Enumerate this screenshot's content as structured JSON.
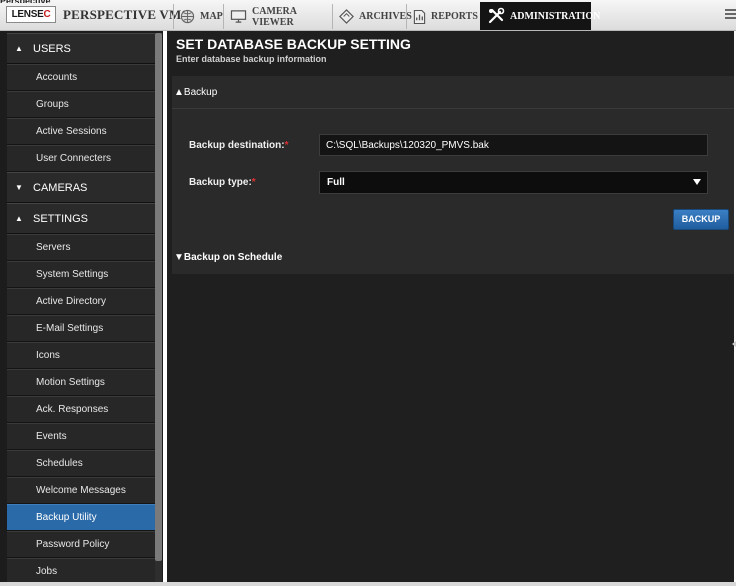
{
  "header": {
    "window_title": "Perspective",
    "logo_text": "LENSEC",
    "app_name": "PERSPECTIVE VMS",
    "tabs": [
      {
        "label": "MAP",
        "icon": "globe-icon"
      },
      {
        "label": "CAMERA VIEWER",
        "icon": "monitor-icon"
      },
      {
        "label": "ARCHIVES",
        "icon": "diamond-icon"
      },
      {
        "label": "REPORTS",
        "icon": "report-icon"
      },
      {
        "label": "ADMINISTRATION",
        "icon": "tools-icon",
        "active": true
      }
    ],
    "menu_icon": "hamburger-menu-icon"
  },
  "sidebar": {
    "sections": [
      {
        "label": "USERS",
        "expanded": true,
        "items": [
          "Accounts",
          "Groups",
          "Active Sessions",
          "User Connecters"
        ]
      },
      {
        "label": "CAMERAS",
        "expanded": false,
        "items": []
      },
      {
        "label": "SETTINGS",
        "expanded": true,
        "items": [
          "Servers",
          "System Settings",
          "Active Directory",
          "E-Mail Settings",
          "Icons",
          "Motion Settings",
          "Ack. Responses",
          "Events",
          "Schedules",
          "Welcome Messages",
          "Backup Utility",
          "Password Policy",
          "Jobs"
        ]
      }
    ],
    "active_item": "Backup Utility",
    "expanded_arrow": "▲",
    "collapsed_arrow": "▼"
  },
  "main": {
    "title": "SET DATABASE BACKUP SETTING",
    "subtitle": "Enter database backup information",
    "backup_section": {
      "header": "▲Backup",
      "destination_label": "Backup destination:",
      "destination_value": "C:\\SQL\\Backups\\120320_PMVS.bak",
      "type_label": "Backup type:",
      "type_value": "Full",
      "required_marker": "*",
      "backup_button": "BACKUP"
    },
    "schedule_section": {
      "header": "▼Backup on Schedule"
    }
  },
  "colors": {
    "accent": "#2b6aa8",
    "button": "#2f74ba",
    "required": "#e03030",
    "panel_bg": "#1f1f1f"
  }
}
